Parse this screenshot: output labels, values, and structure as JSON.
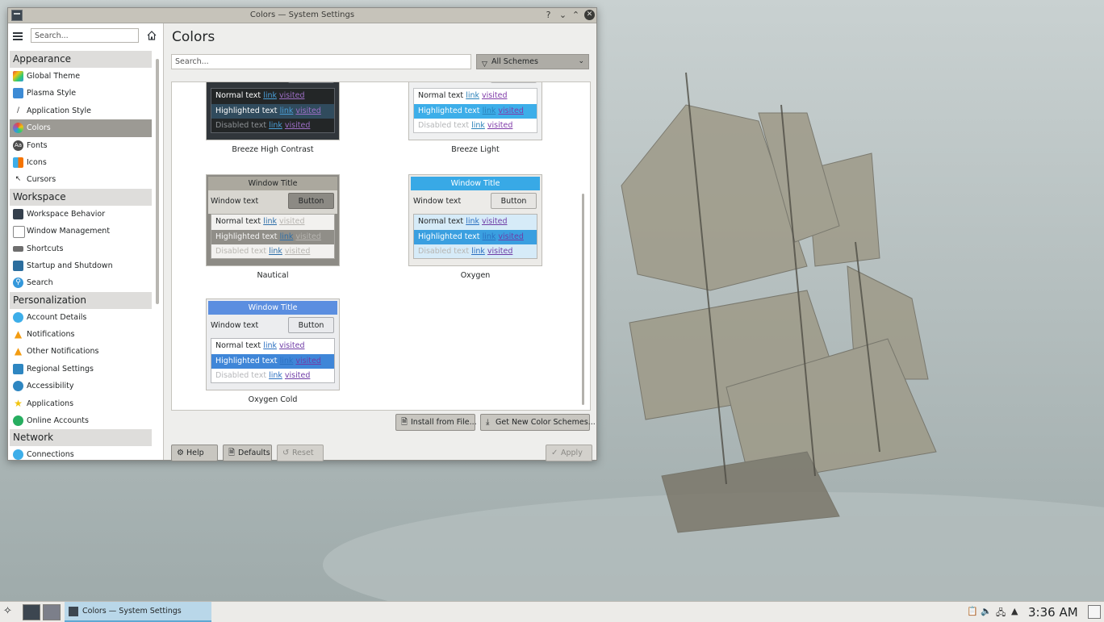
{
  "window": {
    "title": "Colors — System Settings"
  },
  "sidebar": {
    "search_placeholder": "Search...",
    "sections": [
      {
        "header": "Appearance",
        "items": [
          "Global Theme",
          "Plasma Style",
          "Application Style",
          "Colors",
          "Fonts",
          "Icons",
          "Cursors"
        ]
      },
      {
        "header": "Workspace",
        "items": [
          "Workspace Behavior",
          "Window Management",
          "Shortcuts",
          "Startup and Shutdown",
          "Search"
        ]
      },
      {
        "header": "Personalization",
        "items": [
          "Account Details",
          "Notifications",
          "Other Notifications",
          "Regional Settings",
          "Accessibility",
          "Applications",
          "Online Accounts"
        ]
      },
      {
        "header": "Network",
        "items": [
          "Connections"
        ]
      }
    ],
    "active_item": "Colors"
  },
  "main": {
    "title": "Colors",
    "search_placeholder": "Search...",
    "filter_label": "All Schemes",
    "preview_labels": {
      "window_title": "Window Title",
      "window_text": "Window text",
      "button": "Button",
      "normal_text": "Normal text",
      "highlighted_text": "Highlighted text",
      "disabled_text": "Disabled text",
      "link": "link",
      "visited": "visited"
    },
    "schemes": [
      {
        "name": "Breeze High Contrast",
        "colors": {
          "title_bg": "#31363b",
          "title_fg": "#eff0f1",
          "win_bg": "#31363b",
          "win_fg": "#eff0f1",
          "btn_bg": "#31363b",
          "btn_fg": "#eff0f1",
          "btn_border": "#6d7278",
          "view_bg": "#232627",
          "view_fg": "#fcfcfc",
          "view_border": "#5b6066",
          "hl_bg": "#304b5d",
          "hl_fg": "#fcfcfc",
          "dis_fg": "#8d9194",
          "link": "#4a9fd8",
          "visited": "#9e6fc7",
          "card_bg": "#31363b"
        }
      },
      {
        "name": "Breeze Light",
        "colors": {
          "title_bg": "#eff0f1",
          "title_fg": "#232627",
          "win_bg": "#eff0f1",
          "win_fg": "#232627",
          "btn_bg": "#fcfcfc",
          "btn_fg": "#232627",
          "btn_border": "#b9bbbd",
          "view_bg": "#ffffff",
          "view_fg": "#232627",
          "view_border": "#c2c4c6",
          "hl_bg": "#3daee9",
          "hl_fg": "#fcfcfc",
          "dis_fg": "#b4b6b8",
          "link": "#2980b9",
          "visited": "#7f3aa8",
          "card_bg": "#eff0f1"
        }
      },
      {
        "name": "Nautical",
        "colors": {
          "title_bg": "#aba89e",
          "title_fg": "#232627",
          "win_bg": "#d8d6d0",
          "win_fg": "#232627",
          "btn_bg": "#8c8a84",
          "btn_fg": "#232627",
          "btn_border": "#706e69",
          "view_bg": "#f2f1ef",
          "view_fg": "#232627",
          "view_border": "#a8a6a1",
          "hl_bg": "#908e88",
          "hl_fg": "#f5f5f5",
          "dis_fg": "#b8b6b1",
          "link": "#2d6ea8",
          "visited": "#b6b4b0",
          "card_bg": "#8d8b85"
        }
      },
      {
        "name": "Oxygen",
        "colors": {
          "title_bg": "#38a9e6",
          "title_fg": "#ffffff",
          "win_bg": "#ecebe8",
          "win_fg": "#232627",
          "btn_bg": "#e6e5e2",
          "btn_fg": "#232627",
          "btn_border": "#a8a7a3",
          "view_bg": "#d6ebf8",
          "view_fg": "#232627",
          "view_border": "#b7b6b2",
          "hl_bg": "#3a9fe0",
          "hl_fg": "#ffffff",
          "dis_fg": "#b6b5b2",
          "link": "#2b6fc0",
          "visited": "#6f3ca6",
          "card_bg": "#ecebe8"
        }
      },
      {
        "name": "Oxygen Cold",
        "colors": {
          "title_bg": "#5b8ee0",
          "title_fg": "#ffffff",
          "win_bg": "#ecedef",
          "win_fg": "#232627",
          "btn_bg": "#e9eaed",
          "btn_fg": "#232627",
          "btn_border": "#a8aaae",
          "view_bg": "#ffffff",
          "view_fg": "#232627",
          "view_border": "#b5b7bb",
          "hl_bg": "#3f86d8",
          "hl_fg": "#ffffff",
          "dis_fg": "#b6b7ba",
          "link": "#2b6fc0",
          "visited": "#6f3ca6",
          "card_bg": "#ecedef"
        }
      }
    ],
    "install_button": "Install from File...",
    "get_new_button": "Get New Color Schemes..."
  },
  "footer": {
    "help": "Help",
    "defaults": "Defaults",
    "reset": "Reset",
    "apply": "Apply"
  },
  "taskbar": {
    "task_label": "Colors  — System Settings",
    "clock": "3:36 AM"
  }
}
